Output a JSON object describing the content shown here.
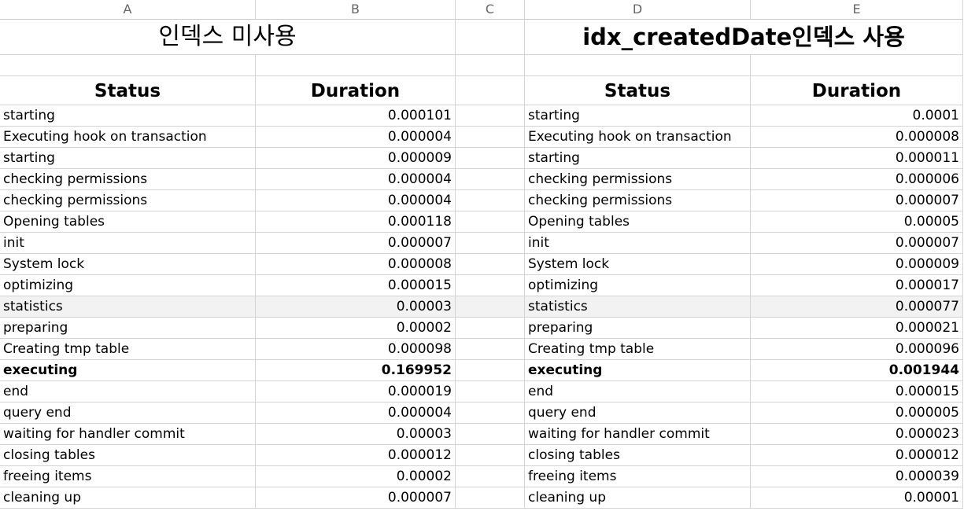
{
  "columns": [
    "A",
    "B",
    "C",
    "D",
    "E"
  ],
  "left_title": "인덱스 미사용",
  "right_title": "idx_createdDate인덱스  사용",
  "headers": {
    "status": "Status",
    "duration": "Duration"
  },
  "rows": [
    {
      "status": "starting",
      "left": "0.000101",
      "right": "0.0001"
    },
    {
      "status": "Executing hook on transaction",
      "left": "0.000004",
      "right": "0.000008"
    },
    {
      "status": "starting",
      "left": "0.000009",
      "right": "0.000011"
    },
    {
      "status": "checking permissions",
      "left": "0.000004",
      "right": "0.000006"
    },
    {
      "status": "checking permissions",
      "left": "0.000004",
      "right": "0.000007"
    },
    {
      "status": "Opening tables",
      "left": "0.000118",
      "right": "0.00005"
    },
    {
      "status": "init",
      "left": "0.000007",
      "right": "0.000007"
    },
    {
      "status": "System lock",
      "left": "0.000008",
      "right": "0.000009"
    },
    {
      "status": "optimizing",
      "left": "0.000015",
      "right": "0.000017"
    },
    {
      "status": "statistics",
      "left": "0.00003",
      "right": "0.000077"
    },
    {
      "status": "preparing",
      "left": "0.00002",
      "right": "0.000021"
    },
    {
      "status": "Creating tmp table",
      "left": "0.000098",
      "right": "0.000096"
    },
    {
      "status": "executing",
      "left": "0.169952",
      "right": "0.001944"
    },
    {
      "status": "end",
      "left": "0.000019",
      "right": "0.000015"
    },
    {
      "status": "query end",
      "left": "0.000004",
      "right": "0.000005"
    },
    {
      "status": "waiting for handler commit",
      "left": "0.00003",
      "right": "0.000023"
    },
    {
      "status": "closing tables",
      "left": "0.000012",
      "right": "0.000012"
    },
    {
      "status": "freeing items",
      "left": "0.00002",
      "right": "0.000039"
    },
    {
      "status": "cleaning up",
      "left": "0.000007",
      "right": "0.00001"
    }
  ]
}
